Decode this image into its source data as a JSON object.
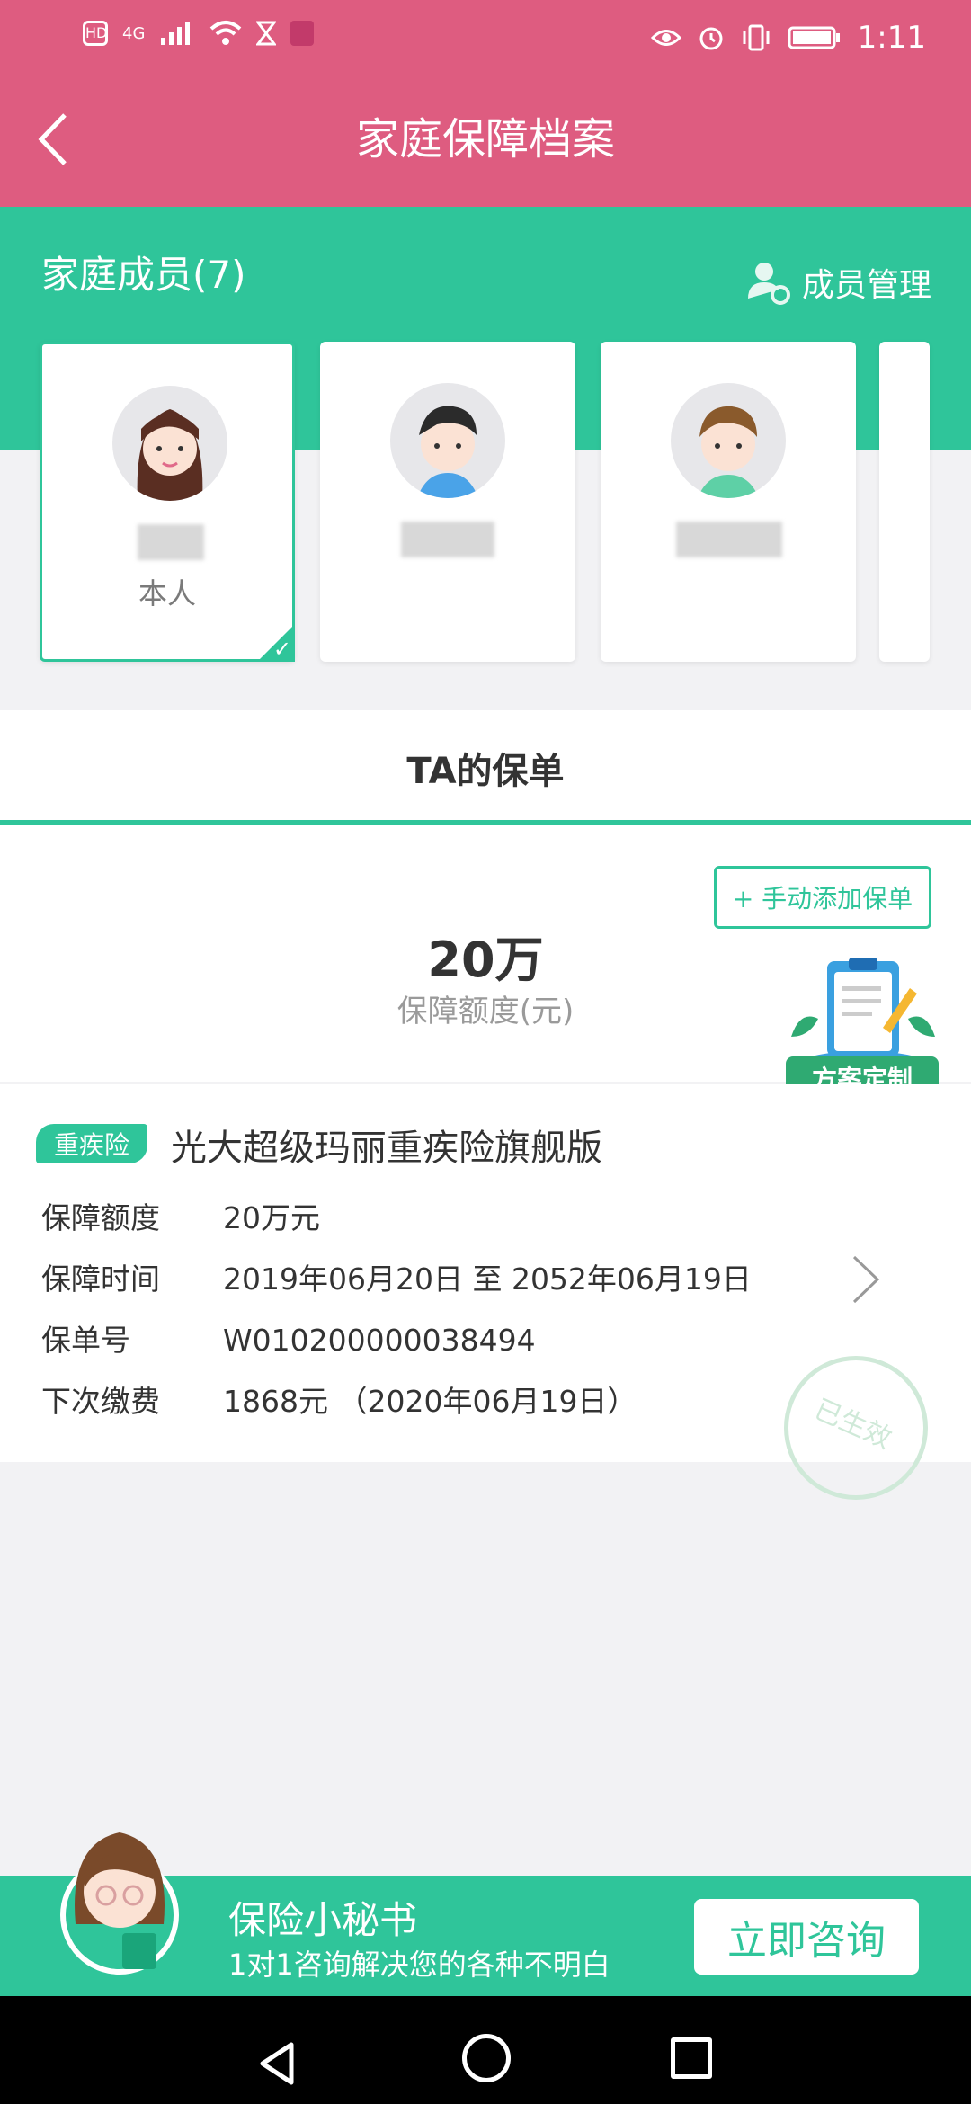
{
  "status_bar": {
    "time": "1:11",
    "hd_label": "HD",
    "net_label": "4G",
    "left_icons": [
      "hd-icon",
      "signal-icon",
      "wifi-icon",
      "hourglass-icon",
      "app-notification-icon"
    ],
    "right_icons": [
      "eye-icon",
      "alarm-icon",
      "vibrate-icon",
      "battery-icon"
    ]
  },
  "header": {
    "title": "家庭保障档案",
    "back_icon": "chevron-left-icon"
  },
  "members": {
    "title": "家庭成员(7)",
    "manage_label": "成员管理",
    "cards": [
      {
        "role": "本人",
        "selected": true
      },
      {
        "role": "",
        "selected": false
      },
      {
        "role": "",
        "selected": false
      }
    ]
  },
  "tab": {
    "label": "TA的保单"
  },
  "summary": {
    "add_button": "+ 手动添加保单",
    "amount": "20万",
    "amount_label": "保障额度(元)",
    "plan_badge": "方案定制"
  },
  "policy": {
    "tag": "重疾险",
    "name": "光大超级玛丽重疾险旗舰版",
    "rows": [
      {
        "key": "保障额度",
        "value": "20万元"
      },
      {
        "key": "保障时间",
        "value": "2019年06月20日 至 2052年06月19日"
      },
      {
        "key": "保单号",
        "value": "W010200000038494"
      },
      {
        "key": "下次缴费",
        "value": "1868元 （2020年06月19日）"
      }
    ],
    "stamp": "已生效"
  },
  "promo": {
    "title": "保险小秘书",
    "subtitle": "1对1咨询解决您的各种不明白",
    "button": "立即咨询"
  },
  "colors": {
    "pink": "#de5c80",
    "teal": "#2fc59a"
  }
}
